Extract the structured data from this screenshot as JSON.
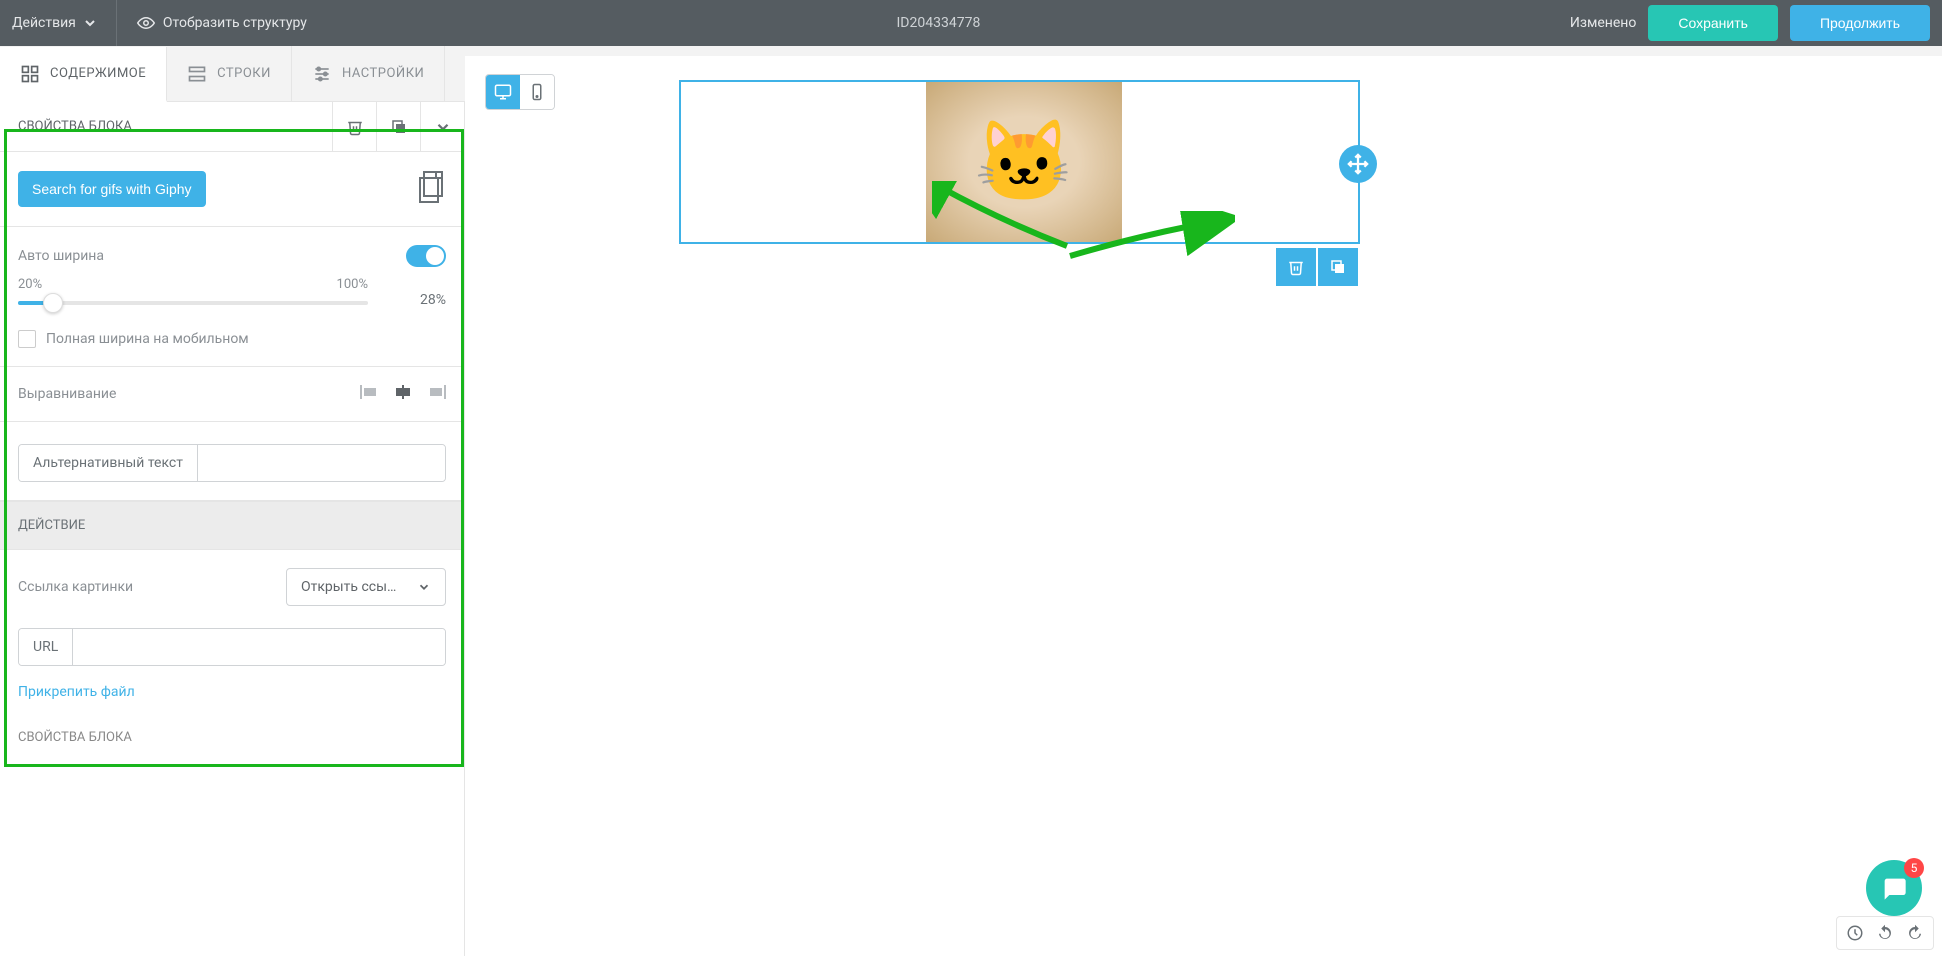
{
  "topbar": {
    "actions_label": "Действия",
    "show_structure": "Отобразить структуру",
    "document_id": "ID204334778",
    "status": "Изменено",
    "save": "Сохранить",
    "continue": "Продолжить"
  },
  "tabs": {
    "content": "СОДЕРЖИМОЕ",
    "rows": "СТРОКИ",
    "settings": "НАСТРОЙКИ"
  },
  "panel": {
    "title": "СВОЙСТВА БЛОКА",
    "giphy_btn": "Search for gifs with Giphy",
    "auto_width": "Авто ширина",
    "slider_min": "20%",
    "slider_max": "100%",
    "slider_value": "28%",
    "full_width_mobile": "Полная ширина на мобильном",
    "alignment": "Выравнивание",
    "alt_text_label": "Альтернативный текст",
    "section_action": "ДЕЙСТВИЕ",
    "image_link": "Ссылка картинки",
    "open_link": "Открыть ссы…",
    "url_label": "URL",
    "attach_file": "Прикрепить файл",
    "lower_title": "СВОЙСТВА БЛОКА"
  },
  "chat": {
    "badge": "5"
  }
}
